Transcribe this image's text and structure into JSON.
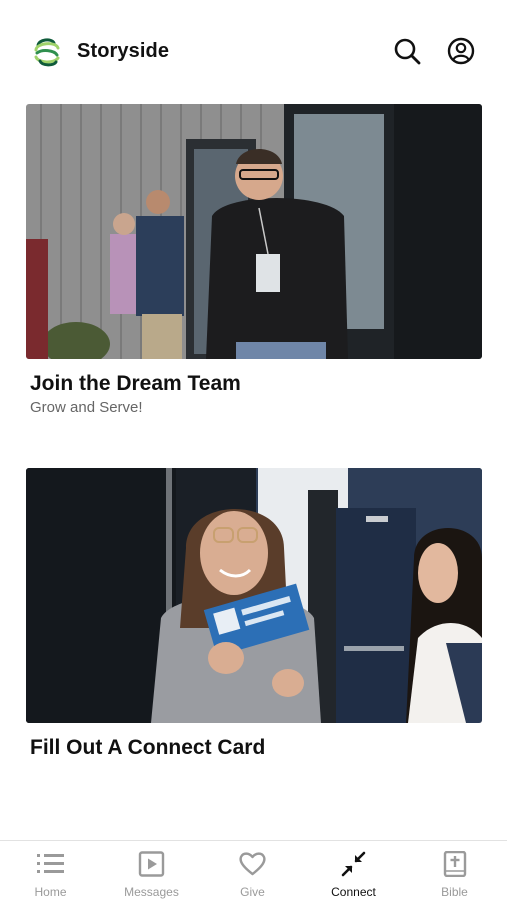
{
  "header": {
    "brand": "Storyside",
    "logo_icon": "storyside-logo",
    "actions": [
      {
        "icon": "search-icon"
      },
      {
        "icon": "account-icon"
      }
    ],
    "colors": {
      "logo_light": "#9fd26a",
      "logo_dark": "#0f5b3a"
    }
  },
  "cards": [
    {
      "title": "Join the Dream Team",
      "subtitle": "Grow and Serve!",
      "image": "volunteer-photo"
    },
    {
      "title": "Fill Out A Connect Card",
      "image": "connect-card-photo"
    }
  ],
  "tabbar": {
    "tabs": [
      {
        "label": "Home",
        "icon": "list-icon",
        "active": false
      },
      {
        "label": "Messages",
        "icon": "play-icon",
        "active": false
      },
      {
        "label": "Give",
        "icon": "heart-icon",
        "active": false
      },
      {
        "label": "Connect",
        "icon": "connect-arrows-icon",
        "active": true
      },
      {
        "label": "Bible",
        "icon": "bible-icon",
        "active": false
      }
    ],
    "active_color": "#111111",
    "inactive_color": "#9a9a9a"
  }
}
